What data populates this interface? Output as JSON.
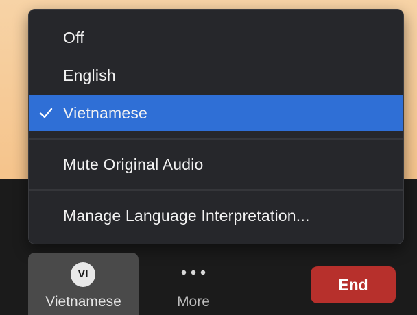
{
  "menu": {
    "items": [
      {
        "label": "Off",
        "selected": false
      },
      {
        "label": "English",
        "selected": false
      },
      {
        "label": "Vietnamese",
        "selected": true
      }
    ],
    "mute_label": "Mute Original Audio",
    "manage_label": "Manage Language Interpretation...",
    "selected_color": "#2f6fd6",
    "check_icon": "checkmark-icon"
  },
  "toolbar": {
    "language_badge": "VI",
    "language_label": "Vietnamese",
    "more_label": "More",
    "more_icon": "ellipsis-icon",
    "end_label": "End",
    "end_color": "#b7302c"
  }
}
